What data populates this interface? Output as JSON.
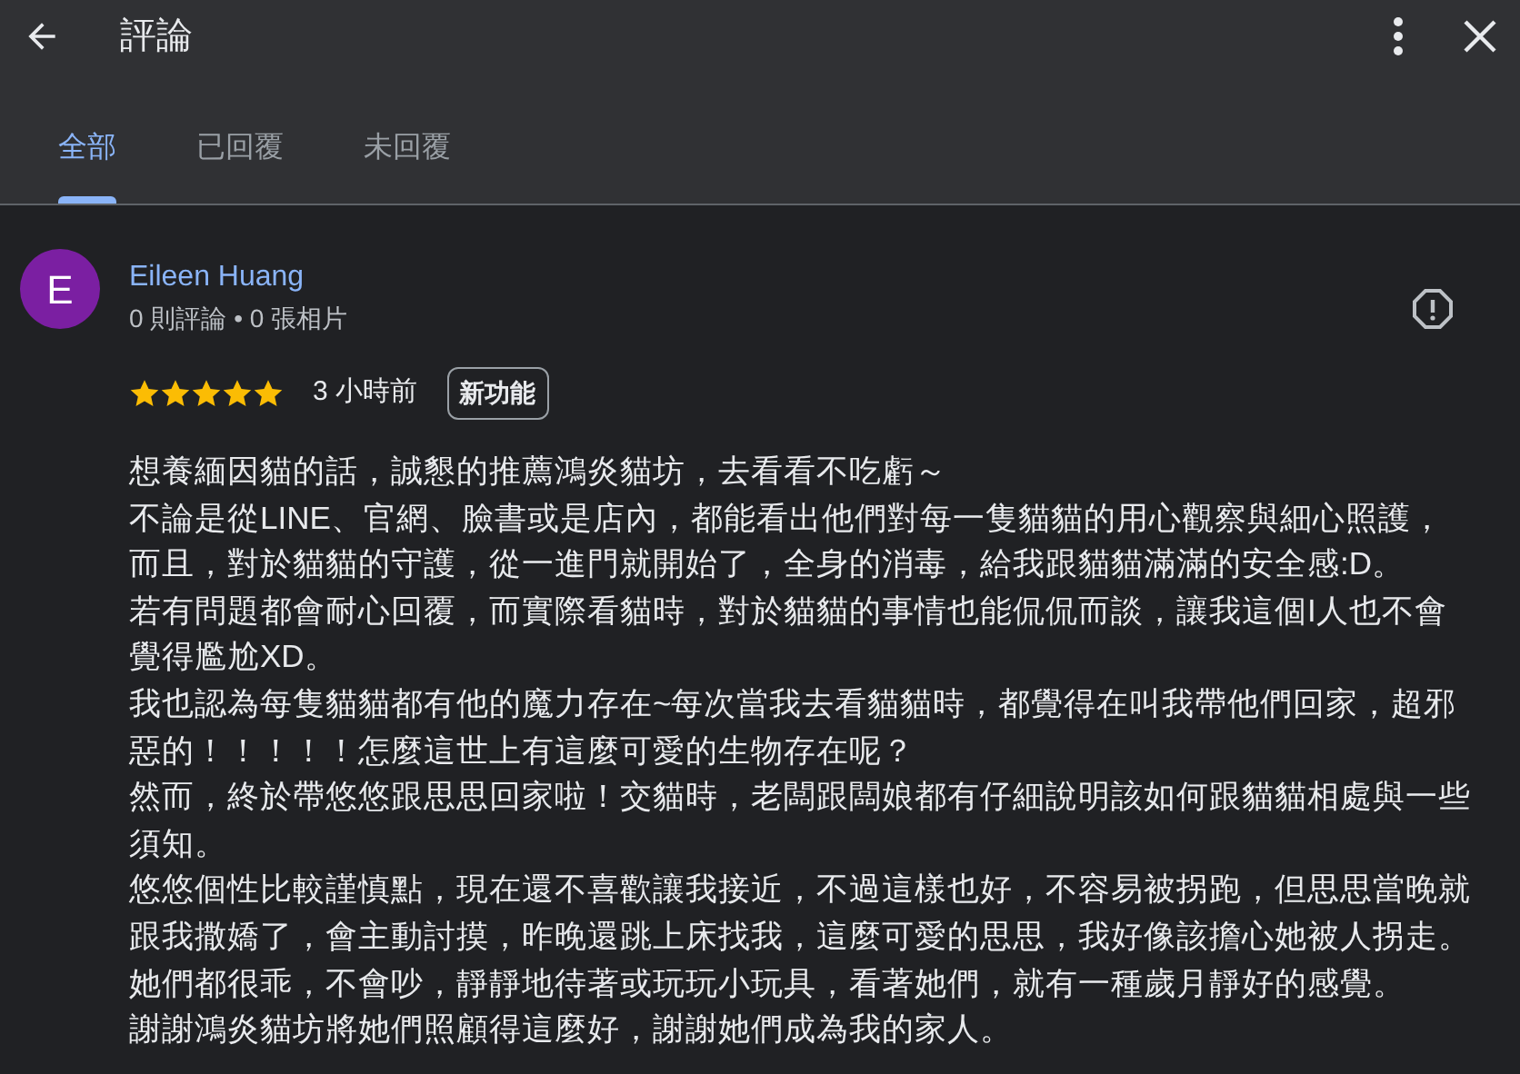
{
  "window": {
    "title": "評論"
  },
  "tabs": [
    {
      "label": "全部",
      "selected": true
    },
    {
      "label": "已回覆",
      "selected": false
    },
    {
      "label": "未回覆",
      "selected": false
    }
  ],
  "review": {
    "avatar_letter": "E",
    "color": "#7b1fa2",
    "author": "Eileen Huang",
    "author_stats": "0 則評論 • 0 張相片",
    "stars": 5,
    "time": "3 小時前",
    "badge": "新功能",
    "paragraphs": [
      "想養緬因貓的話，誠懇的推薦鴻炎貓坊，去看看不吃虧～",
      "不論是從LINE、官網、臉書或是店內，都能看出他們對每一隻貓貓的用心觀察與細心照護，而且，對於貓貓的守護，從一進門就開始了，全身的消毒，給我跟貓貓滿滿的安全感:D。",
      "若有問題都會耐心回覆，而實際看貓時，對於貓貓的事情也能侃侃而談，讓我這個I人也不會覺得尷尬XD。",
      "我也認為每隻貓貓都有他的魔力存在~每次當我去看貓貓時，都覺得在叫我帶他們回家，超邪惡的！！！！！怎麼這世上有這麼可愛的生物存在呢？",
      "然而，終於帶悠悠跟思思回家啦！交貓時，老闆跟闆娘都有仔細說明該如何跟貓貓相處與一些須知。",
      "悠悠個性比較謹慎點，現在還不喜歡讓我接近，不過這樣也好，不容易被拐跑，但思思當晚就跟我撒嬌了，會主動討摸，昨晚還跳上床找我，這麼可愛的思思，我好像該擔心她被人拐走。",
      "她們都很乖，不會吵，靜靜地待著或玩玩小玩具，看著她們，就有一種歲月靜好的感覺。",
      "謝謝鴻炎貓坊將她們照顧得這麼好，謝謝她們成為我的家人。"
    ]
  }
}
